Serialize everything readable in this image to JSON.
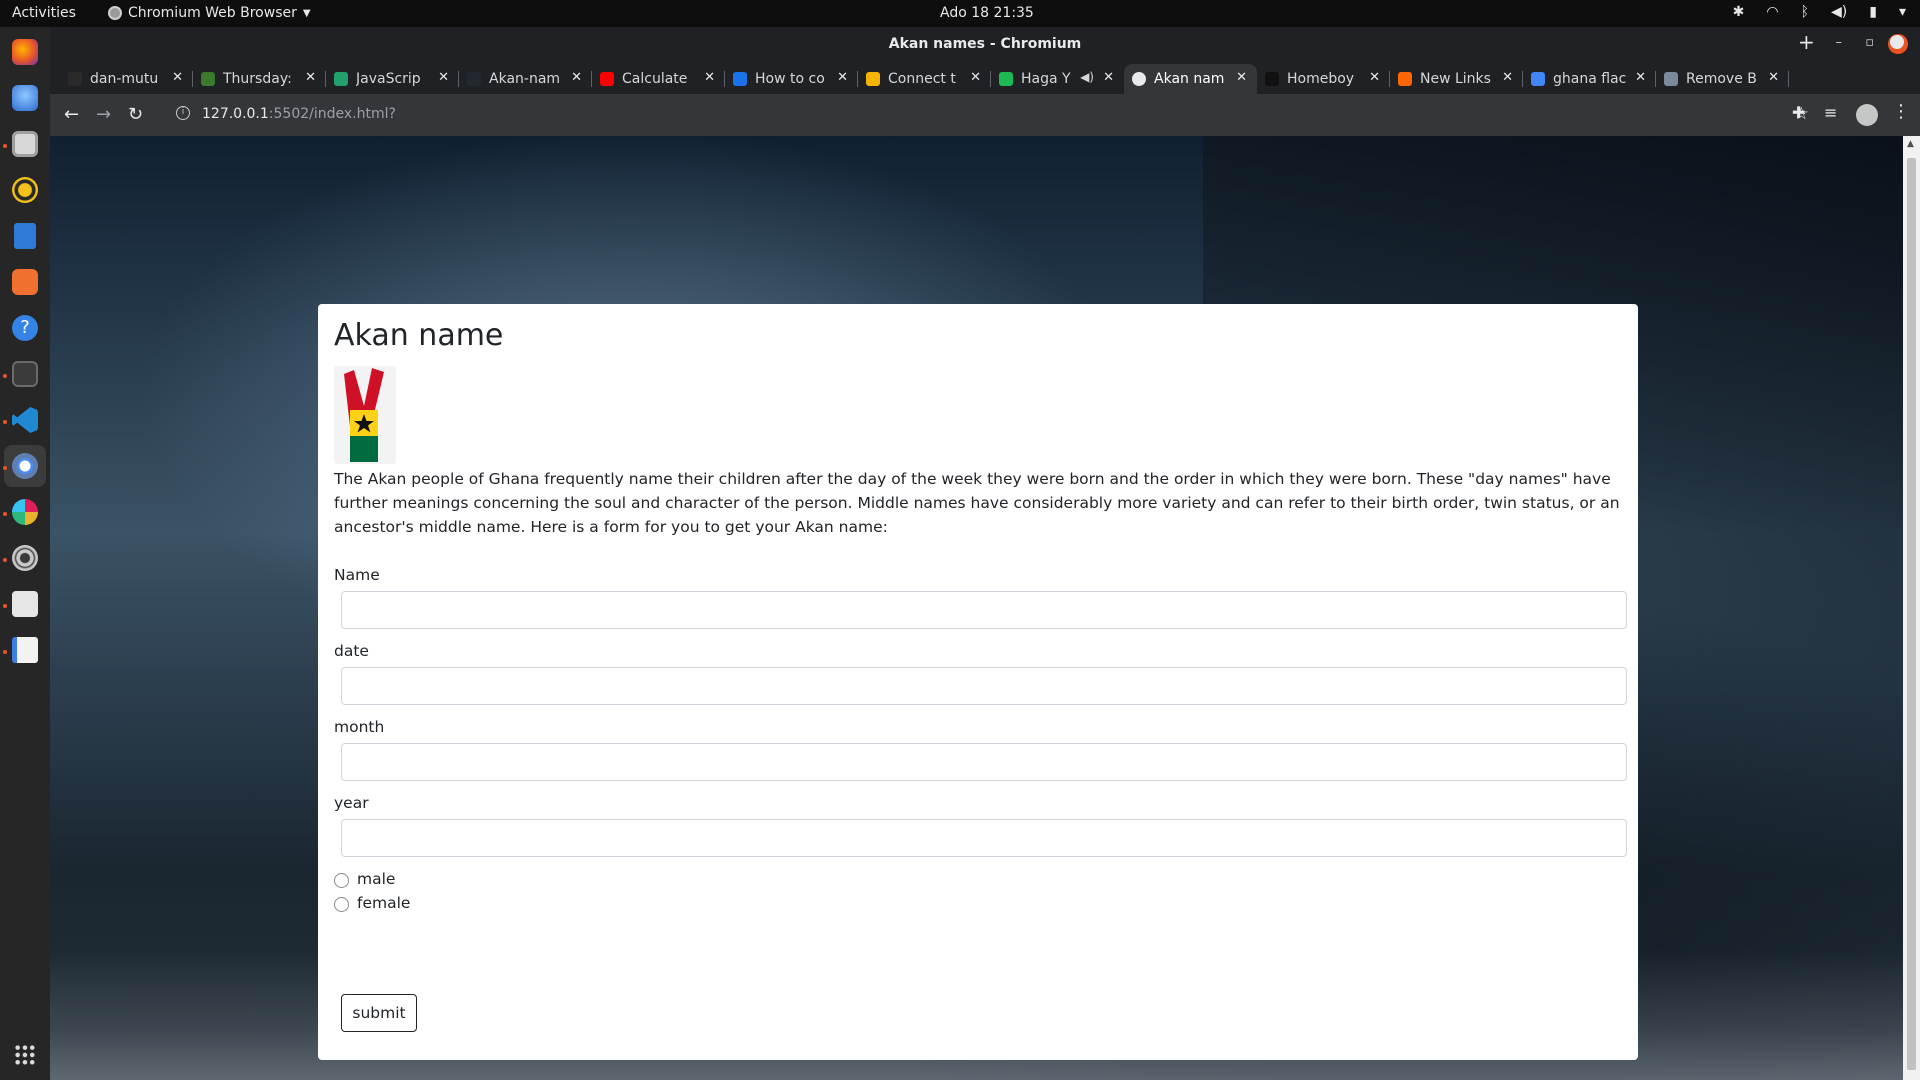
{
  "system": {
    "activities": "Activities",
    "app_name": "Chromium Web Browser",
    "clock": "Ado 18  21:35"
  },
  "dock": {
    "items": [
      "firefox-icon",
      "thunderbird-icon",
      "files-icon",
      "rhythmbox-icon",
      "libreoffice-writer-icon",
      "ubuntu-software-icon",
      "help-icon",
      "terminal-icon",
      "vscode-icon",
      "chromium-icon",
      "slack-icon",
      "settings-icon",
      "screenshot-icon",
      "text-editor-icon",
      "show-applications-icon"
    ]
  },
  "window": {
    "title": "Akan names - Chromium"
  },
  "tabs": [
    {
      "label": "dan-mutu",
      "color": "#2a2a2a"
    },
    {
      "label": "Thursday:",
      "color": "#3a7a2a"
    },
    {
      "label": "JavaScrip",
      "color": "#22a06b"
    },
    {
      "label": "Akan-nam",
      "color": "#24292f"
    },
    {
      "label": "Calculate",
      "color": "#ff0000"
    },
    {
      "label": "How to co",
      "color": "#1a73e8"
    },
    {
      "label": "Connect t",
      "color": "#f4b400"
    },
    {
      "label": "Haga Y",
      "color": "#1db954"
    },
    {
      "label": "Akan nam",
      "color": "#e8eaed"
    },
    {
      "label": "Homeboy",
      "color": "#111111"
    },
    {
      "label": "New Links",
      "color": "#ff6600"
    },
    {
      "label": "ghana flac",
      "color": "#4285f4"
    },
    {
      "label": "Remove B",
      "color": "#7b8a9a"
    }
  ],
  "address": {
    "host": "127.0.0.1",
    "path": ":5502/index.html?"
  },
  "page": {
    "heading": "Akan name",
    "intro": "The Akan people of Ghana frequently name their children after the day of the week they were born and the order in which they were born. These \"day names\" have further meanings concerning the soul and character of the person. Middle names have considerably more variety and can refer to their birth order, twin status, or an ancestor's middle name. Here is a form for you to get your Akan name:",
    "fields": {
      "name_label": "Name",
      "name_value": "",
      "date_label": "date",
      "date_value": "",
      "month_label": "month",
      "month_value": "",
      "year_label": "year",
      "year_value": ""
    },
    "gender": {
      "male_label": "male",
      "female_label": "female",
      "selected": ""
    },
    "submit_label": "submit"
  }
}
